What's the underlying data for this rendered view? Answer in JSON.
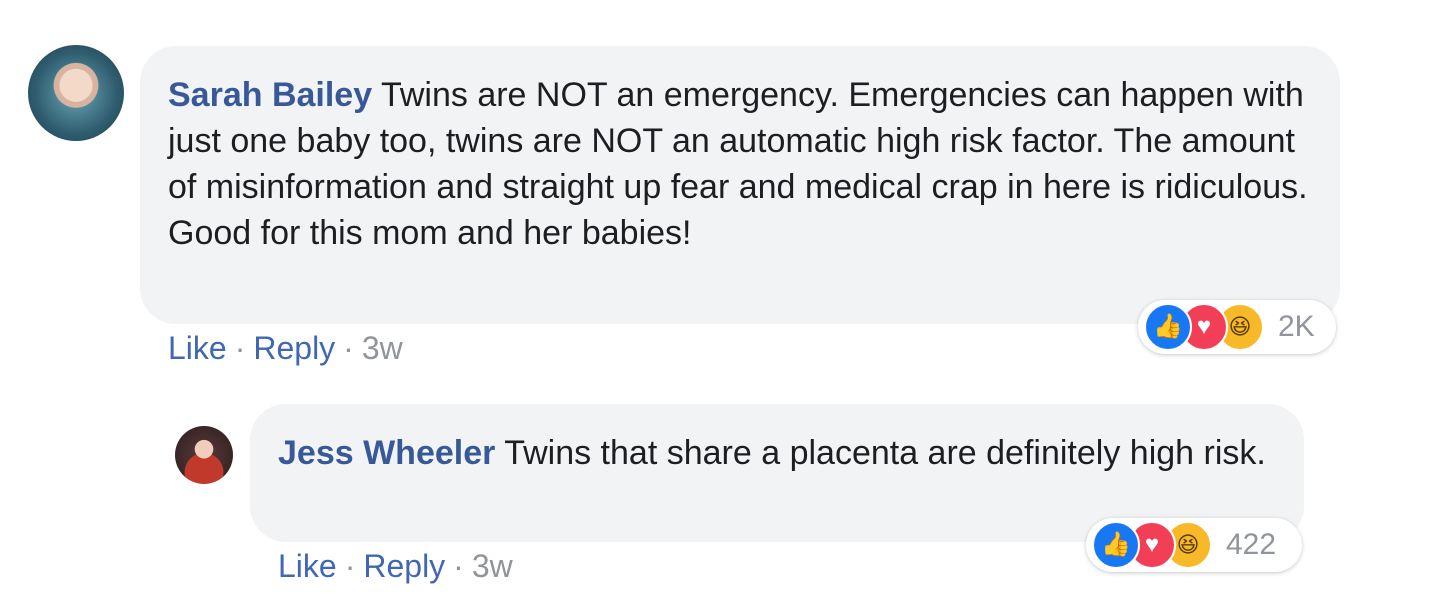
{
  "comments": [
    {
      "author": "Sarah Bailey",
      "text": "Twins are NOT an emergency. Emergencies can happen with just one baby too, twins are NOT an automatic high risk factor. The amount of misinformation and straight up fear and medical crap in here is ridiculous. Good for this mom and her babies!",
      "like_label": "Like",
      "reply_label": "Reply",
      "separator": "·",
      "time": "3w",
      "reactions": {
        "count": "2K",
        "icons": [
          "like-icon",
          "love-icon",
          "haha-icon"
        ]
      }
    },
    {
      "author": "Jess Wheeler",
      "text": "Twins that share a placenta are definitely high risk.",
      "like_label": "Like",
      "reply_label": "Reply",
      "separator": "·",
      "time": "3w",
      "reactions": {
        "count": "422",
        "icons": [
          "like-icon",
          "love-icon",
          "haha-icon"
        ]
      }
    }
  ],
  "colors": {
    "author": "#385898",
    "link": "#4267b2",
    "bubble": "#f2f3f5",
    "meta": "#90949c",
    "like": "#1877f2",
    "love": "#f33e58",
    "haha": "#f7b928"
  }
}
